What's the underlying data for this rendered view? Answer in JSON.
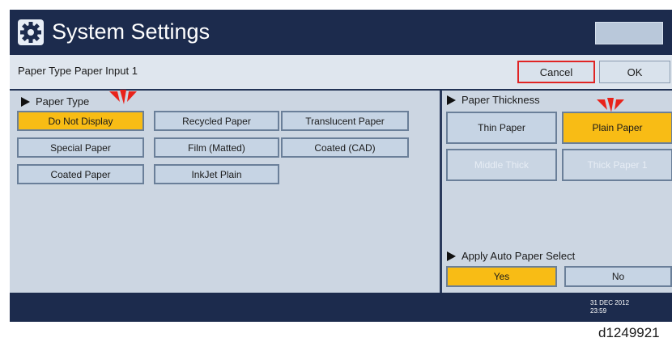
{
  "header": {
    "title": "System Settings",
    "icon": "gear-icon"
  },
  "subheader": {
    "title": "Paper Type Paper Input 1",
    "cancel_label": "Cancel",
    "ok_label": "OK"
  },
  "paper_type": {
    "heading": "Paper Type",
    "options": [
      {
        "label": "Do Not Display",
        "selected": true
      },
      {
        "label": "Recycled Paper",
        "selected": false
      },
      {
        "label": "Translucent Paper",
        "selected": false
      },
      {
        "label": "Special Paper",
        "selected": false
      },
      {
        "label": "Film (Matted)",
        "selected": false
      },
      {
        "label": "Coated (CAD)",
        "selected": false
      },
      {
        "label": "Coated Paper",
        "selected": false
      },
      {
        "label": "InkJet Plain",
        "selected": false
      }
    ]
  },
  "paper_thickness": {
    "heading": "Paper Thickness",
    "options": [
      {
        "label": "Thin Paper",
        "selected": false,
        "enabled": true
      },
      {
        "label": "Plain Paper",
        "selected": true,
        "enabled": true
      },
      {
        "label": "Middle Thick",
        "selected": false,
        "enabled": false
      },
      {
        "label": "Thick Paper 1",
        "selected": false,
        "enabled": false
      }
    ]
  },
  "auto_select": {
    "heading": "Apply Auto Paper Select",
    "yes_label": "Yes",
    "no_label": "No",
    "selected": "Yes"
  },
  "status": {
    "date": "31 DEC 2012",
    "time": "23:59"
  },
  "figure_id": "d1249921",
  "colors": {
    "selected": "#f8bc15",
    "title_bar": "#1c2b4d",
    "highlight_border": "#e02424",
    "marker": "#e8231b"
  }
}
